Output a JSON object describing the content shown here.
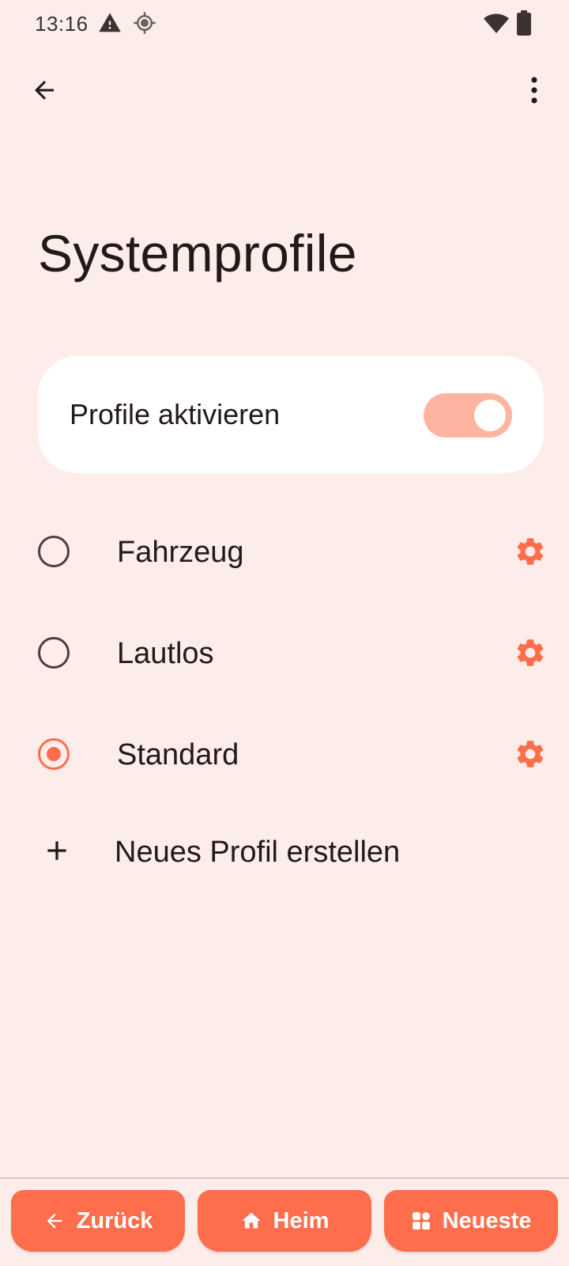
{
  "status_bar": {
    "time": "13:16",
    "icons": [
      "alert-triangle-icon",
      "location-crosshair-icon",
      "wifi-icon",
      "battery-icon"
    ]
  },
  "toolbar": {
    "back_icon": "arrow-back-icon",
    "menu_icon": "more-vert-icon"
  },
  "page": {
    "title": "Systemprofile"
  },
  "toggle_card": {
    "label": "Profile aktivieren",
    "enabled": true
  },
  "profiles": [
    {
      "label": "Fahrzeug",
      "selected": false,
      "settings_icon": "gear-icon"
    },
    {
      "label": "Lautlos",
      "selected": false,
      "settings_icon": "gear-icon"
    },
    {
      "label": "Standard",
      "selected": true,
      "settings_icon": "gear-icon"
    }
  ],
  "add_profile": {
    "icon": "plus-icon",
    "label": "Neues Profil erstellen"
  },
  "nav_bar": {
    "back": {
      "label": "Zurück",
      "icon": "arrow-left-icon"
    },
    "home": {
      "label": "Heim",
      "icon": "home-icon"
    },
    "recents": {
      "label": "Neueste",
      "icon": "grid-icon"
    }
  },
  "colors": {
    "background": "#fcedea",
    "accent": "#ff6e4c",
    "switch_track": "#ffb4a1",
    "card": "#ffffff",
    "text": "#231918"
  }
}
